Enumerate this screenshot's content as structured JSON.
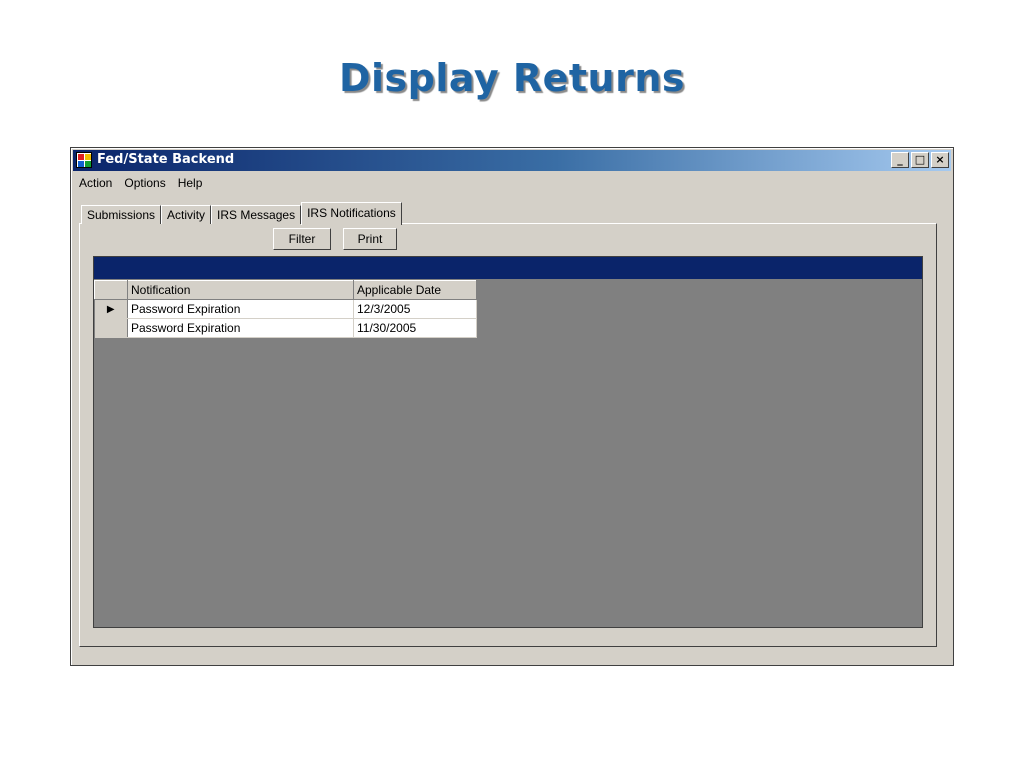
{
  "slide": {
    "title": "Display Returns"
  },
  "window": {
    "title": "Fed/State Backend",
    "controls": {
      "minimize": "_",
      "maximize": "□",
      "close": "×"
    }
  },
  "menu": [
    "Action",
    "Options",
    "Help"
  ],
  "tabs": [
    "Submissions",
    "Activity",
    "IRS Messages",
    "IRS Notifications"
  ],
  "active_tab": "IRS Notifications",
  "toolbar": {
    "filter_label": "Filter",
    "print_label": "Print"
  },
  "grid": {
    "columns": [
      "Notification",
      "Applicable Date"
    ],
    "rows": [
      {
        "notification": "Password Expiration",
        "date": "12/3/2005",
        "current": "▶"
      },
      {
        "notification": "Password Expiration",
        "date": "11/30/2005",
        "current": ""
      }
    ]
  },
  "colors": {
    "title_blue": "#1f64a3",
    "titlebar_dark": "#0a246a",
    "grid_bg": "#808080"
  }
}
